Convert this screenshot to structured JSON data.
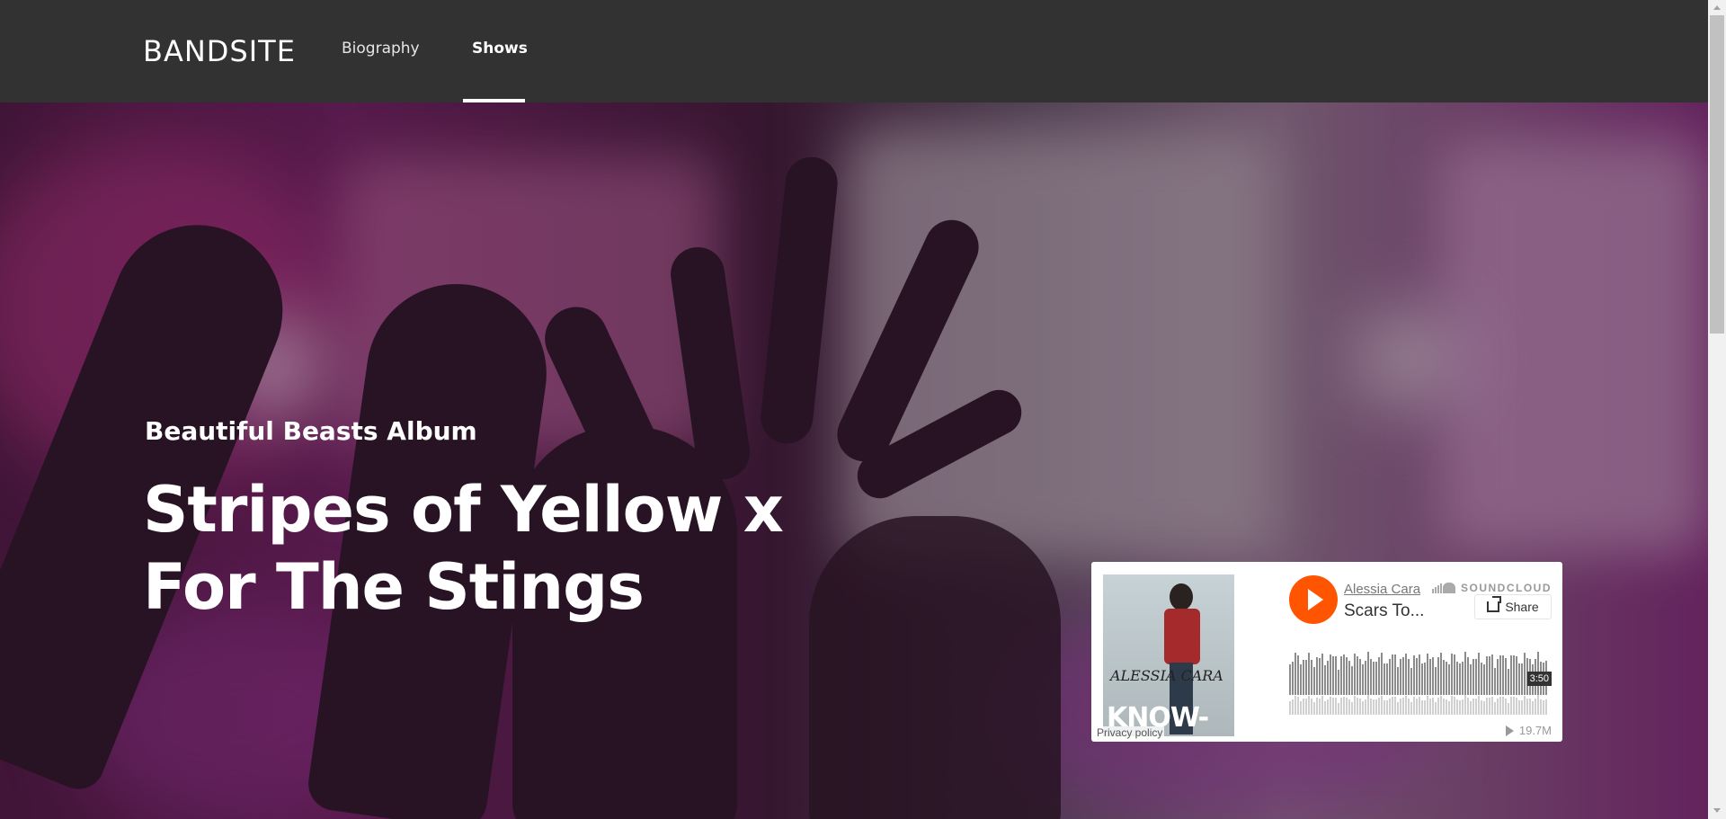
{
  "header": {
    "logo": "BANDSITE",
    "nav": [
      {
        "label": "Biography",
        "active": false
      },
      {
        "label": "Shows",
        "active": true
      }
    ]
  },
  "hero": {
    "subtitle": "Beautiful Beasts Album",
    "title": "Stripes of Yellow x For The Stings"
  },
  "soundcloud": {
    "artist": "Alessia Cara",
    "track": "Scars To...",
    "brand": "SOUNDCLOUD",
    "share_label": "Share",
    "duration": "3:50",
    "plays": "19.7M",
    "privacy": "Privacy policy",
    "art_script": "ALESSIA CARA",
    "art_title": "KNOW-IT-ALL",
    "accent": "#ff5500"
  },
  "colors": {
    "header_bg": "#323232",
    "text": "#ffffff"
  }
}
